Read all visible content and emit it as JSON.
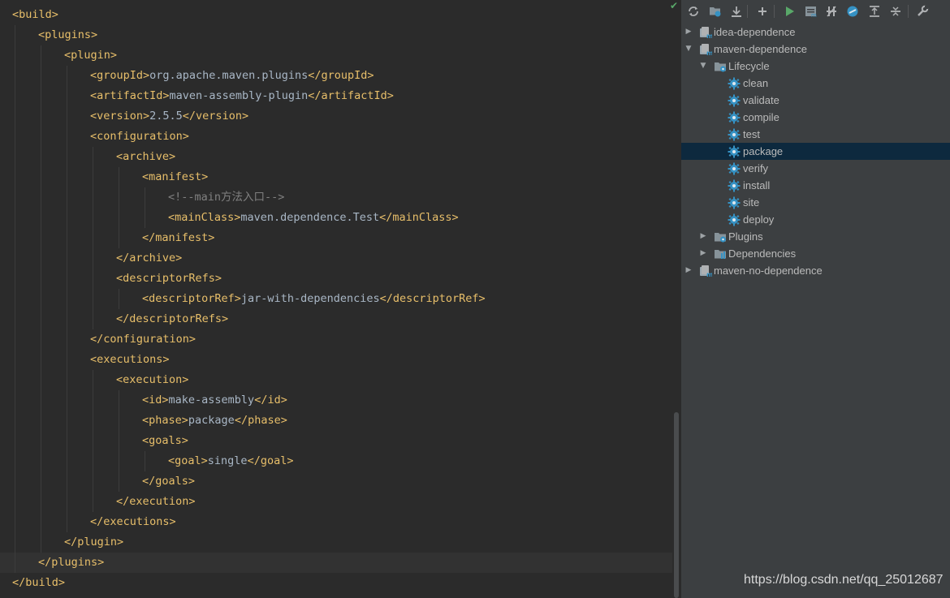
{
  "editor": {
    "lines": [
      {
        "depth": 0,
        "tokens": [
          {
            "c": "tag",
            "t": "<build>"
          }
        ]
      },
      {
        "depth": 1,
        "tokens": [
          {
            "c": "tag",
            "t": "<plugins>"
          }
        ]
      },
      {
        "depth": 2,
        "tokens": [
          {
            "c": "tag",
            "t": "<plugin>"
          }
        ]
      },
      {
        "depth": 3,
        "tokens": [
          {
            "c": "tag",
            "t": "<groupId>"
          },
          {
            "c": "txt",
            "t": "org.apache.maven.plugins"
          },
          {
            "c": "tag",
            "t": "</groupId>"
          }
        ]
      },
      {
        "depth": 3,
        "tokens": [
          {
            "c": "tag",
            "t": "<artifactId>"
          },
          {
            "c": "txt",
            "t": "maven-assembly-plugin"
          },
          {
            "c": "tag",
            "t": "</artifactId>"
          }
        ]
      },
      {
        "depth": 3,
        "tokens": [
          {
            "c": "tag",
            "t": "<version>"
          },
          {
            "c": "txt",
            "t": "2.5.5"
          },
          {
            "c": "tag",
            "t": "</version>"
          }
        ]
      },
      {
        "depth": 3,
        "tokens": [
          {
            "c": "tag",
            "t": "<configuration>"
          }
        ]
      },
      {
        "depth": 4,
        "tokens": [
          {
            "c": "tag",
            "t": "<archive>"
          }
        ]
      },
      {
        "depth": 5,
        "tokens": [
          {
            "c": "tag",
            "t": "<manifest>"
          }
        ]
      },
      {
        "depth": 6,
        "tokens": [
          {
            "c": "cmt",
            "t": "<!--main方法入口-->"
          }
        ]
      },
      {
        "depth": 6,
        "tokens": [
          {
            "c": "tag",
            "t": "<mainClass>"
          },
          {
            "c": "txt",
            "t": "maven.dependence.Test"
          },
          {
            "c": "tag",
            "t": "</mainClass>"
          }
        ]
      },
      {
        "depth": 5,
        "tokens": [
          {
            "c": "tag",
            "t": "</manifest>"
          }
        ]
      },
      {
        "depth": 4,
        "tokens": [
          {
            "c": "tag",
            "t": "</archive>"
          }
        ]
      },
      {
        "depth": 4,
        "tokens": [
          {
            "c": "tag",
            "t": "<descriptorRefs>"
          }
        ]
      },
      {
        "depth": 5,
        "tokens": [
          {
            "c": "tag",
            "t": "<descriptorRef>"
          },
          {
            "c": "txt",
            "t": "jar-with-dependencies"
          },
          {
            "c": "tag",
            "t": "</descriptorRef>"
          }
        ]
      },
      {
        "depth": 4,
        "tokens": [
          {
            "c": "tag",
            "t": "</descriptorRefs>"
          }
        ]
      },
      {
        "depth": 3,
        "tokens": [
          {
            "c": "tag",
            "t": "</configuration>"
          }
        ]
      },
      {
        "depth": 3,
        "tokens": [
          {
            "c": "tag",
            "t": "<executions>"
          }
        ]
      },
      {
        "depth": 4,
        "tokens": [
          {
            "c": "tag",
            "t": "<execution>"
          }
        ]
      },
      {
        "depth": 5,
        "tokens": [
          {
            "c": "tag",
            "t": "<id>"
          },
          {
            "c": "txt",
            "t": "make-assembly"
          },
          {
            "c": "tag",
            "t": "</id>"
          }
        ]
      },
      {
        "depth": 5,
        "tokens": [
          {
            "c": "tag",
            "t": "<phase>"
          },
          {
            "c": "txt",
            "t": "package"
          },
          {
            "c": "tag",
            "t": "</phase>"
          }
        ]
      },
      {
        "depth": 5,
        "tokens": [
          {
            "c": "tag",
            "t": "<goals>"
          }
        ]
      },
      {
        "depth": 6,
        "tokens": [
          {
            "c": "tag",
            "t": "<goal>"
          },
          {
            "c": "txt",
            "t": "single"
          },
          {
            "c": "tag",
            "t": "</goal>"
          }
        ]
      },
      {
        "depth": 5,
        "tokens": [
          {
            "c": "tag",
            "t": "</goals>"
          }
        ]
      },
      {
        "depth": 4,
        "tokens": [
          {
            "c": "tag",
            "t": "</execution>"
          }
        ]
      },
      {
        "depth": 3,
        "tokens": [
          {
            "c": "tag",
            "t": "</executions>"
          }
        ]
      },
      {
        "depth": 2,
        "tokens": [
          {
            "c": "tag",
            "t": "</plugin>"
          }
        ]
      },
      {
        "depth": 1,
        "current": true,
        "tokens": [
          {
            "c": "tag",
            "t": "</plugins>"
          }
        ]
      },
      {
        "depth": 0,
        "tokens": [
          {
            "c": "tag",
            "t": "</build>"
          }
        ]
      }
    ]
  },
  "toolbar": {
    "buttons": [
      {
        "name": "reimport-icon"
      },
      {
        "name": "generate-sources-icon"
      },
      {
        "name": "download-sources-icon"
      },
      {
        "name": "add-project-icon"
      },
      {
        "name": "run-icon"
      },
      {
        "name": "execute-goal-icon"
      },
      {
        "name": "toggle-offline-icon"
      },
      {
        "name": "skip-tests-icon"
      },
      {
        "name": "show-diagram-icon"
      },
      {
        "name": "collapse-all-icon"
      },
      {
        "name": "settings-icon"
      }
    ]
  },
  "tree": [
    {
      "label": "idea-dependence",
      "level": 0,
      "arrow": "collapsed",
      "icon": "maven-module-icon"
    },
    {
      "label": "maven-dependence",
      "level": 0,
      "arrow": "expanded",
      "icon": "maven-module-icon"
    },
    {
      "label": "Lifecycle",
      "level": 1,
      "arrow": "expanded",
      "icon": "lifecycle-folder-icon"
    },
    {
      "label": "clean",
      "level": 2,
      "arrow": "none",
      "icon": "gear-icon"
    },
    {
      "label": "validate",
      "level": 2,
      "arrow": "none",
      "icon": "gear-icon"
    },
    {
      "label": "compile",
      "level": 2,
      "arrow": "none",
      "icon": "gear-icon"
    },
    {
      "label": "test",
      "level": 2,
      "arrow": "none",
      "icon": "gear-icon"
    },
    {
      "label": "package",
      "level": 2,
      "arrow": "none",
      "icon": "gear-icon",
      "selected": true
    },
    {
      "label": "verify",
      "level": 2,
      "arrow": "none",
      "icon": "gear-icon"
    },
    {
      "label": "install",
      "level": 2,
      "arrow": "none",
      "icon": "gear-icon"
    },
    {
      "label": "site",
      "level": 2,
      "arrow": "none",
      "icon": "gear-icon"
    },
    {
      "label": "deploy",
      "level": 2,
      "arrow": "none",
      "icon": "gear-icon"
    },
    {
      "label": "Plugins",
      "level": 1,
      "arrow": "collapsed",
      "icon": "plugins-folder-icon"
    },
    {
      "label": "Dependencies",
      "level": 1,
      "arrow": "collapsed",
      "icon": "dependencies-icon"
    },
    {
      "label": "maven-no-dependence",
      "level": 0,
      "arrow": "collapsed",
      "icon": "maven-module-icon"
    }
  ],
  "watermark": "https://blog.csdn.net/qq_25012687",
  "colors": {
    "editor_bg": "#2b2b2b",
    "tag": "#e8bf6a",
    "text": "#a9b7c6",
    "comment": "#808080",
    "panel_bg": "#3c3f41",
    "selection": "#0d293e",
    "gear": "#3592c4",
    "run": "#59a869"
  }
}
